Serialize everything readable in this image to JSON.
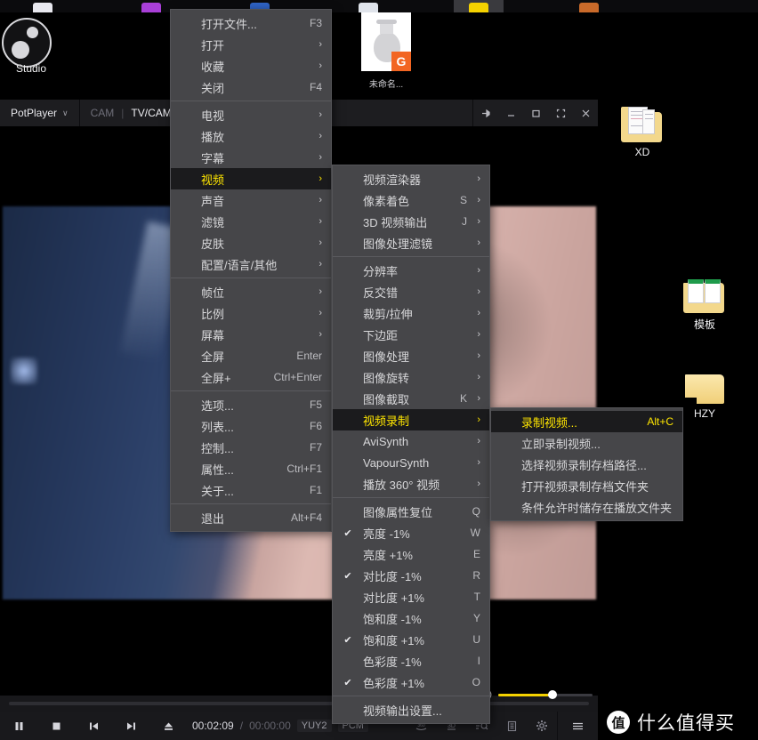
{
  "desktop": {
    "obs": {
      "label": "Studio",
      "icon": "obs-studio-icon"
    },
    "icons": [
      {
        "name": "XD",
        "type": "folder-documents"
      },
      {
        "name": "模板",
        "type": "folder-books"
      },
      {
        "name": "HZY",
        "type": "folder-plain"
      }
    ],
    "thumbnail": {
      "caption": "未命名...",
      "badge": "G"
    }
  },
  "player": {
    "app_name": "PotPlayer",
    "chevron": "∨",
    "tabs": [
      {
        "label": "CAM",
        "active": false
      },
      {
        "label": "TV/CAM/",
        "active": true
      }
    ],
    "tab_separator": "|",
    "window_buttons": [
      {
        "name": "pin-button",
        "glyph": "pin"
      },
      {
        "name": "minimize-button",
        "glyph": "minimize"
      },
      {
        "name": "maximize-button",
        "glyph": "maximize"
      },
      {
        "name": "fullscreen-button",
        "glyph": "fullscreen"
      },
      {
        "name": "close-button",
        "glyph": "close"
      }
    ],
    "controls": {
      "pause": "pause-icon",
      "stop": "stop-icon",
      "previous": "previous-icon",
      "next": "next-icon",
      "eject": "eject-icon",
      "current_time": "00:02:09",
      "time_separator": "/",
      "total_time": "00:00:00",
      "video_codec": "YUY2",
      "audio_codec": "PCM",
      "right_icons": [
        "360-icon",
        "3d-icon",
        "search-icon",
        "playlist-icon",
        "settings-icon",
        "menu-icon"
      ]
    },
    "volume": {
      "icon": "volume-icon",
      "level": 58
    }
  },
  "watermark": {
    "badge": "值",
    "text": "什么值得买"
  },
  "menu_file": {
    "items": [
      {
        "label": "打开文件...",
        "accel": "F3",
        "arrow": false,
        "sep_after": false
      },
      {
        "label": "打开",
        "accel": "",
        "arrow": true,
        "sep_after": false
      },
      {
        "label": "收藏",
        "accel": "",
        "arrow": true,
        "sep_after": false
      },
      {
        "label": "关闭",
        "accel": "F4",
        "arrow": false,
        "sep_after": true
      },
      {
        "label": "电视",
        "accel": "",
        "arrow": true,
        "sep_after": false
      },
      {
        "label": "播放",
        "accel": "",
        "arrow": true,
        "sep_after": false
      },
      {
        "label": "字幕",
        "accel": "",
        "arrow": true,
        "sep_after": false
      },
      {
        "label": "视频",
        "accel": "",
        "arrow": true,
        "sep_after": false,
        "selected": true
      },
      {
        "label": "声音",
        "accel": "",
        "arrow": true,
        "sep_after": false
      },
      {
        "label": "滤镜",
        "accel": "",
        "arrow": true,
        "sep_after": false
      },
      {
        "label": "皮肤",
        "accel": "",
        "arrow": true,
        "sep_after": false
      },
      {
        "label": "配置/语言/其他",
        "accel": "",
        "arrow": true,
        "sep_after": true
      },
      {
        "label": "帧位",
        "accel": "",
        "arrow": true,
        "sep_after": false
      },
      {
        "label": "比例",
        "accel": "",
        "arrow": true,
        "sep_after": false
      },
      {
        "label": "屏幕",
        "accel": "",
        "arrow": true,
        "sep_after": false
      },
      {
        "label": "全屏",
        "accel": "Enter",
        "arrow": false,
        "sep_after": false
      },
      {
        "label": "全屏+",
        "accel": "Ctrl+Enter",
        "arrow": false,
        "sep_after": true
      },
      {
        "label": "选项...",
        "accel": "F5",
        "arrow": false,
        "sep_after": false
      },
      {
        "label": "列表...",
        "accel": "F6",
        "arrow": false,
        "sep_after": false
      },
      {
        "label": "控制...",
        "accel": "F7",
        "arrow": false,
        "sep_after": false
      },
      {
        "label": "属性...",
        "accel": "Ctrl+F1",
        "arrow": false,
        "sep_after": false
      },
      {
        "label": "关于...",
        "accel": "F1",
        "arrow": false,
        "sep_after": true
      },
      {
        "label": "退出",
        "accel": "Alt+F4",
        "arrow": false,
        "sep_after": false
      }
    ]
  },
  "menu_video": {
    "items": [
      {
        "label": "视频渲染器",
        "accel": "",
        "arrow": true,
        "sep_after": false
      },
      {
        "label": "像素着色",
        "accel": "S",
        "arrow": true,
        "sep_after": false
      },
      {
        "label": "3D 视频输出",
        "accel": "J",
        "arrow": true,
        "sep_after": false
      },
      {
        "label": "图像处理滤镜",
        "accel": "",
        "arrow": true,
        "sep_after": true
      },
      {
        "label": "分辨率",
        "accel": "",
        "arrow": true,
        "sep_after": false
      },
      {
        "label": "反交错",
        "accel": "",
        "arrow": true,
        "sep_after": false
      },
      {
        "label": "裁剪/拉伸",
        "accel": "",
        "arrow": true,
        "sep_after": false
      },
      {
        "label": "下边距",
        "accel": "",
        "arrow": true,
        "sep_after": false
      },
      {
        "label": "图像处理",
        "accel": "",
        "arrow": true,
        "sep_after": false
      },
      {
        "label": "图像旋转",
        "accel": "",
        "arrow": true,
        "sep_after": false
      },
      {
        "label": "图像截取",
        "accel": "K",
        "arrow": true,
        "sep_after": false
      },
      {
        "label": "视频录制",
        "accel": "",
        "arrow": true,
        "sep_after": false,
        "selected": true
      },
      {
        "label": "AviSynth",
        "accel": "",
        "arrow": true,
        "sep_after": false
      },
      {
        "label": "VapourSynth",
        "accel": "",
        "arrow": true,
        "sep_after": false
      },
      {
        "label": "播放 360° 视频",
        "accel": "",
        "arrow": true,
        "sep_after": true
      },
      {
        "label": "图像属性复位",
        "accel": "Q",
        "arrow": false,
        "sep_after": false
      },
      {
        "label": "亮度 -1%",
        "accel": "W",
        "arrow": false,
        "sep_after": false,
        "checked": true
      },
      {
        "label": "亮度 +1%",
        "accel": "E",
        "arrow": false,
        "sep_after": false
      },
      {
        "label": "对比度 -1%",
        "accel": "R",
        "arrow": false,
        "sep_after": false,
        "checked": true
      },
      {
        "label": "对比度 +1%",
        "accel": "T",
        "arrow": false,
        "sep_after": false
      },
      {
        "label": "饱和度 -1%",
        "accel": "Y",
        "arrow": false,
        "sep_after": false
      },
      {
        "label": "饱和度 +1%",
        "accel": "U",
        "arrow": false,
        "sep_after": false,
        "checked": true
      },
      {
        "label": "色彩度 -1%",
        "accel": "I",
        "arrow": false,
        "sep_after": false
      },
      {
        "label": "色彩度 +1%",
        "accel": "O",
        "arrow": false,
        "sep_after": false,
        "checked": true
      },
      {
        "label": "视频输出设置...",
        "accel": "",
        "arrow": false,
        "sep_after": false,
        "sep_before": true
      }
    ]
  },
  "menu_record": {
    "items": [
      {
        "label": "录制视频...",
        "accel": "Alt+C",
        "arrow": false,
        "selected": true
      },
      {
        "label": "立即录制视频...",
        "accel": "",
        "arrow": false
      },
      {
        "label": "选择视频录制存档路径...",
        "accel": "",
        "arrow": false
      },
      {
        "label": "打开视频录制存档文件夹",
        "accel": "",
        "arrow": false
      },
      {
        "label": "条件允许时储存在播放文件夹",
        "accel": "",
        "arrow": false
      }
    ]
  }
}
